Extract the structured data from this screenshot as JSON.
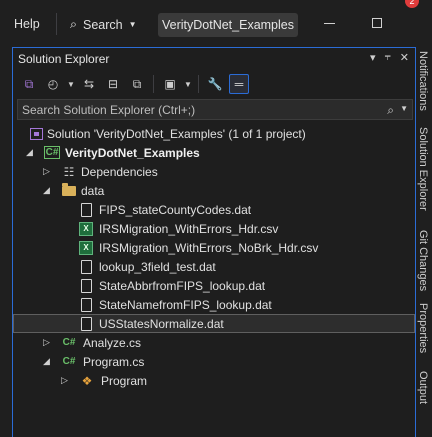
{
  "menu": {
    "help": "Help",
    "search": "Search",
    "project": "VerityDotNet_Examples",
    "notify_count": "2"
  },
  "right_tabs": [
    "Notifications",
    "Solution Explorer",
    "Git Changes",
    "Properties",
    "Output"
  ],
  "panel": {
    "title": "Solution Explorer",
    "search_placeholder": "Search Solution Explorer (Ctrl+;)"
  },
  "tree": {
    "solution": "Solution 'VerityDotNet_Examples' (1 of 1 project)",
    "project": "VerityDotNet_Examples",
    "dependencies": "Dependencies",
    "data_folder": "data",
    "files": [
      "FIPS_stateCountyCodes.dat",
      "IRSMigration_WithErrors_Hdr.csv",
      "IRSMigration_WithErrors_NoBrk_Hdr.csv",
      "lookup_3field_test.dat",
      "StateAbbrfromFIPS_lookup.dat",
      "StateNamefromFIPS_lookup.dat",
      "USStatesNormalize.dat"
    ],
    "analyze": "Analyze.cs",
    "program": "Program.cs",
    "program_class": "Program"
  }
}
